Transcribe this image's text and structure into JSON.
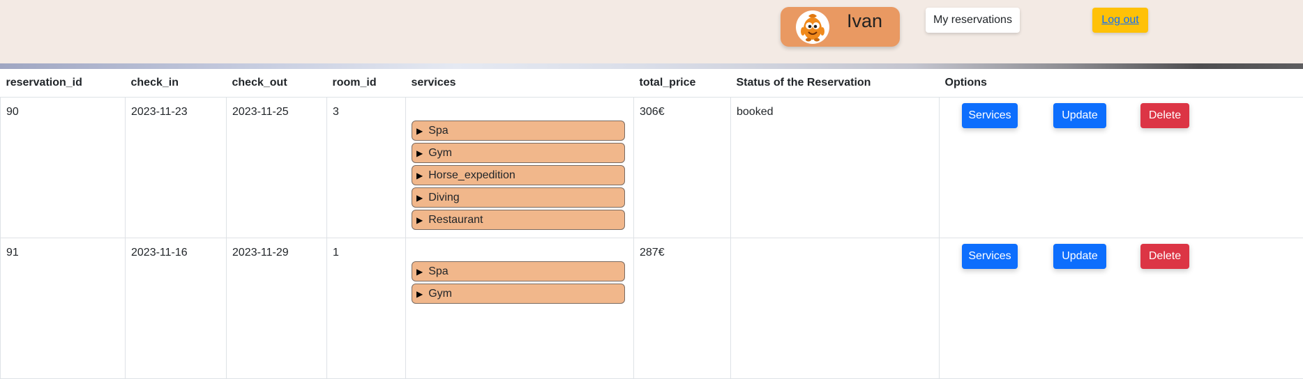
{
  "header": {
    "user_name": "Ivan",
    "avatar_icon": "cartoon-mascot-avatar",
    "my_reservations_label": "My reservations",
    "logout_label": "Log out",
    "colors": {
      "background": "#f3eae4",
      "user_pill": "#e99962",
      "logout_bg": "#ffc107",
      "logout_text": "#0d6efd"
    }
  },
  "table": {
    "headers": [
      "reservation_id",
      "check_in",
      "check_out",
      "room_id",
      "services",
      "total_price",
      "Status of the Reservation",
      "Options"
    ],
    "rows": [
      {
        "reservation_id": "90",
        "check_in": "2023-11-23",
        "check_out": "2023-11-25",
        "room_id": "3",
        "services": [
          "Spa",
          "Gym",
          "Horse_expedition",
          "Diving",
          "Restaurant"
        ],
        "total_price": "306€",
        "status": "booked",
        "options": {
          "services": "Services",
          "update": "Update",
          "delete": "Delete"
        }
      },
      {
        "reservation_id": "91",
        "check_in": "2023-11-16",
        "check_out": "2023-11-29",
        "room_id": "1",
        "services": [
          "Spa",
          "Gym"
        ],
        "total_price": "287€",
        "status": "",
        "options": {
          "services": "Services",
          "update": "Update",
          "delete": "Delete"
        }
      }
    ],
    "colors": {
      "service_bg": "#f1b78b",
      "primary": "#0d6efd",
      "danger": "#dc3545"
    }
  }
}
